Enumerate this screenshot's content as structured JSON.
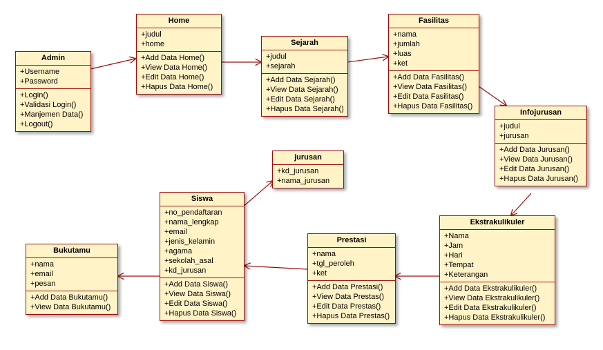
{
  "classes": {
    "admin": {
      "title": "Admin",
      "attrs": [
        "+Username",
        "+Password"
      ],
      "ops": [
        "+Login()",
        "+Validasi Login()",
        "+Manjemen Data()",
        "+Logout()"
      ]
    },
    "home": {
      "title": "Home",
      "attrs": [
        "+judul",
        "+home"
      ],
      "ops": [
        "+Add Data Home()",
        "+View Data Home()",
        "+Edit Data Home()",
        "+Hapus Data Home()"
      ]
    },
    "sejarah": {
      "title": "Sejarah",
      "attrs": [
        "+judul",
        "+sejarah"
      ],
      "ops": [
        "+Add Data Sejarah()",
        "+View Data Sejarah()",
        "+Edit Data Sejarah()",
        "+Hapus Data Sejarah()"
      ]
    },
    "fasilitas": {
      "title": "Fasilitas",
      "attrs": [
        "+nama",
        "+jumlah",
        "+luas",
        "+ket"
      ],
      "ops": [
        "+Add Data Fasilitas()",
        "+View  Data Fasilitas()",
        "+Edit  Data Fasilitas()",
        "+Hapus  Data Fasilitas()"
      ]
    },
    "infojurusan": {
      "title": "Infojurusan",
      "attrs": [
        "+judul",
        "+jurusan"
      ],
      "ops": [
        "+Add Data Jurusan()",
        "+View Data Jurusan()",
        "+Edit  Data Jurusan()",
        "+Hapus  Data Jurusan()"
      ]
    },
    "jurusan": {
      "title": "jurusan",
      "attrs": [
        "+kd_jurusan",
        "+nama_jurusan"
      ],
      "ops": []
    },
    "siswa": {
      "title": "Siswa",
      "attrs": [
        "+no_pendaftaran",
        "+nama_lengkap",
        "+email",
        "+jenis_kelamin",
        "+agama",
        "+sekolah_asal",
        "+kd_jurusan"
      ],
      "ops": [
        "+Add Data Siswa()",
        "+View Data Siswa()",
        "+Edit Data Siswa()",
        "+Hapus Data Siswa()"
      ]
    },
    "prestasi": {
      "title": "Prestasi",
      "attrs": [
        "+nama",
        "+tgl_peroleh",
        "+ket"
      ],
      "ops": [
        "+Add Data Prestasi()",
        "+View Data Prestas()",
        "+Edit Data Prestas()",
        "+Hapus Data Prestas()"
      ]
    },
    "ekstrakulikuler": {
      "title": "Ekstrakulikuler",
      "attrs": [
        "+Nama",
        "+Jam",
        "+Hari",
        "+Tempat",
        "+Keterangan"
      ],
      "ops": [
        "+Add Data Ekstrakulikuler()",
        "+View Data Ekstrakulikuler()",
        "+Edit Data Ekstrakulikuler()",
        "+Hapus Data Ekstrakulikuler()"
      ]
    },
    "bukutamu": {
      "title": "Bukutamu",
      "attrs": [
        "+nama",
        "+email",
        "+pesan"
      ],
      "ops": [
        "+Add Data Bukutamu()",
        "+View Data Bukutamu()"
      ]
    }
  },
  "chart_data": {
    "type": "diagram",
    "diagram_kind": "uml-class",
    "classes": [
      {
        "name": "Admin",
        "attributes": [
          "Username",
          "Password"
        ],
        "operations": [
          "Login()",
          "Validasi Login()",
          "Manjemen Data()",
          "Logout()"
        ]
      },
      {
        "name": "Home",
        "attributes": [
          "judul",
          "home"
        ],
        "operations": [
          "Add Data Home()",
          "View Data Home()",
          "Edit Data Home()",
          "Hapus Data Home()"
        ]
      },
      {
        "name": "Sejarah",
        "attributes": [
          "judul",
          "sejarah"
        ],
        "operations": [
          "Add Data Sejarah()",
          "View Data Sejarah()",
          "Edit Data Sejarah()",
          "Hapus Data Sejarah()"
        ]
      },
      {
        "name": "Fasilitas",
        "attributes": [
          "nama",
          "jumlah",
          "luas",
          "ket"
        ],
        "operations": [
          "Add Data Fasilitas()",
          "View Data Fasilitas()",
          "Edit Data Fasilitas()",
          "Hapus Data Fasilitas()"
        ]
      },
      {
        "name": "Infojurusan",
        "attributes": [
          "judul",
          "jurusan"
        ],
        "operations": [
          "Add Data Jurusan()",
          "View Data Jurusan()",
          "Edit Data Jurusan()",
          "Hapus Data Jurusan()"
        ]
      },
      {
        "name": "jurusan",
        "attributes": [
          "kd_jurusan",
          "nama_jurusan"
        ],
        "operations": []
      },
      {
        "name": "Siswa",
        "attributes": [
          "no_pendaftaran",
          "nama_lengkap",
          "email",
          "jenis_kelamin",
          "agama",
          "sekolah_asal",
          "kd_jurusan"
        ],
        "operations": [
          "Add Data Siswa()",
          "View Data Siswa()",
          "Edit Data Siswa()",
          "Hapus Data Siswa()"
        ]
      },
      {
        "name": "Prestasi",
        "attributes": [
          "nama",
          "tgl_peroleh",
          "ket"
        ],
        "operations": [
          "Add Data Prestasi()",
          "View Data Prestas()",
          "Edit Data Prestas()",
          "Hapus Data Prestas()"
        ]
      },
      {
        "name": "Ekstrakulikuler",
        "attributes": [
          "Nama",
          "Jam",
          "Hari",
          "Tempat",
          "Keterangan"
        ],
        "operations": [
          "Add Data Ekstrakulikuler()",
          "View Data Ekstrakulikuler()",
          "Edit Data Ekstrakulikuler()",
          "Hapus Data Ekstrakulikuler()"
        ]
      },
      {
        "name": "Bukutamu",
        "attributes": [
          "nama",
          "email",
          "pesan"
        ],
        "operations": [
          "Add Data Bukutamu()",
          "View Data Bukutamu()"
        ]
      }
    ],
    "associations": [
      {
        "from": "Admin",
        "to": "Home"
      },
      {
        "from": "Home",
        "to": "Sejarah"
      },
      {
        "from": "Sejarah",
        "to": "Fasilitas"
      },
      {
        "from": "Fasilitas",
        "to": "Infojurusan"
      },
      {
        "from": "Infojurusan",
        "to": "Ekstrakulikuler"
      },
      {
        "from": "Ekstrakulikuler",
        "to": "Prestasi"
      },
      {
        "from": "Prestasi",
        "to": "Siswa"
      },
      {
        "from": "Siswa",
        "to": "jurusan"
      },
      {
        "from": "Siswa",
        "to": "Bukutamu"
      }
    ]
  }
}
